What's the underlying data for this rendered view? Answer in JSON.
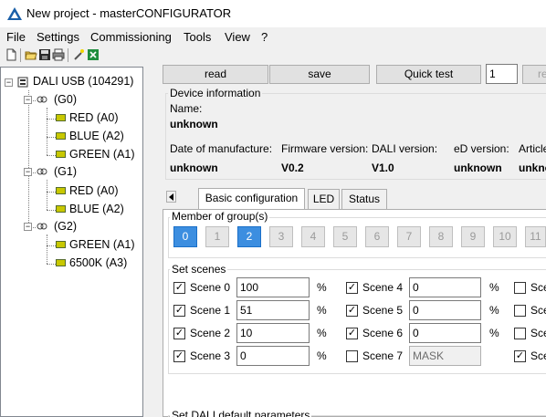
{
  "window": {
    "title": "New project - masterCONFIGURATOR"
  },
  "menu": [
    "File",
    "Settings",
    "Commissioning",
    "Tools",
    "View",
    "?"
  ],
  "toolbar_icons": [
    "new-file-icon",
    "open-folder-icon",
    "save-disk-icon",
    "print-icon",
    "wand-icon",
    "excel-icon"
  ],
  "tree": {
    "root": "DALI USB (104291)",
    "groups": [
      {
        "label": "(G0)",
        "devices": [
          "RED (A0)",
          "BLUE (A2)",
          "GREEN (A1)"
        ]
      },
      {
        "label": "(G1)",
        "devices": [
          "RED (A0)",
          "BLUE (A2)"
        ]
      },
      {
        "label": "(G2)",
        "devices": [
          "GREEN (A1)",
          "6500K (A3)"
        ]
      }
    ]
  },
  "actions": {
    "read": "read",
    "save": "save",
    "quick_test": "Quick test",
    "count_value": "1",
    "re_label": "re"
  },
  "device_info": {
    "legend": "Device information",
    "name_label": "Name:",
    "name_value": "unknown",
    "date_label": "Date of manufacture:",
    "date_value": "unknown",
    "firmware_label": "Firmware version:",
    "firmware_value": "V0.2",
    "dali_label": "DALI version:",
    "dali_value": "V1.0",
    "ed_label": "eD version:",
    "ed_value": "unknown",
    "article_label": "Article",
    "article_value": "unkno"
  },
  "tabs": [
    "Basic configuration",
    "LED",
    "Status"
  ],
  "groups_box": {
    "legend": "Member of group(s)",
    "buttons": [
      "0",
      "1",
      "2",
      "3",
      "4",
      "5",
      "6",
      "7",
      "8",
      "9",
      "10",
      "11"
    ],
    "selected": [
      "0",
      "2"
    ]
  },
  "scenes_box": {
    "legend": "Set scenes",
    "col1": [
      {
        "label": "Scene 0",
        "value": "100",
        "checked": true
      },
      {
        "label": "Scene 1",
        "value": "51",
        "checked": true
      },
      {
        "label": "Scene 2",
        "value": "10",
        "checked": true
      },
      {
        "label": "Scene 3",
        "value": "0",
        "checked": true
      }
    ],
    "col2": [
      {
        "label": "Scene 4",
        "value": "0",
        "checked": true
      },
      {
        "label": "Scene 5",
        "value": "0",
        "checked": true
      },
      {
        "label": "Scene 6",
        "value": "0",
        "checked": true
      },
      {
        "label": "Scene 7",
        "value": "MASK",
        "checked": false
      }
    ],
    "col3": [
      {
        "label": "Sce",
        "checked": false
      },
      {
        "label": "Sce",
        "checked": false
      },
      {
        "label": "Sce",
        "checked": false
      },
      {
        "label": "Sce",
        "checked": true
      }
    ],
    "unit": "%"
  },
  "dali_defaults": {
    "legend": "Set DALI default parameters"
  }
}
